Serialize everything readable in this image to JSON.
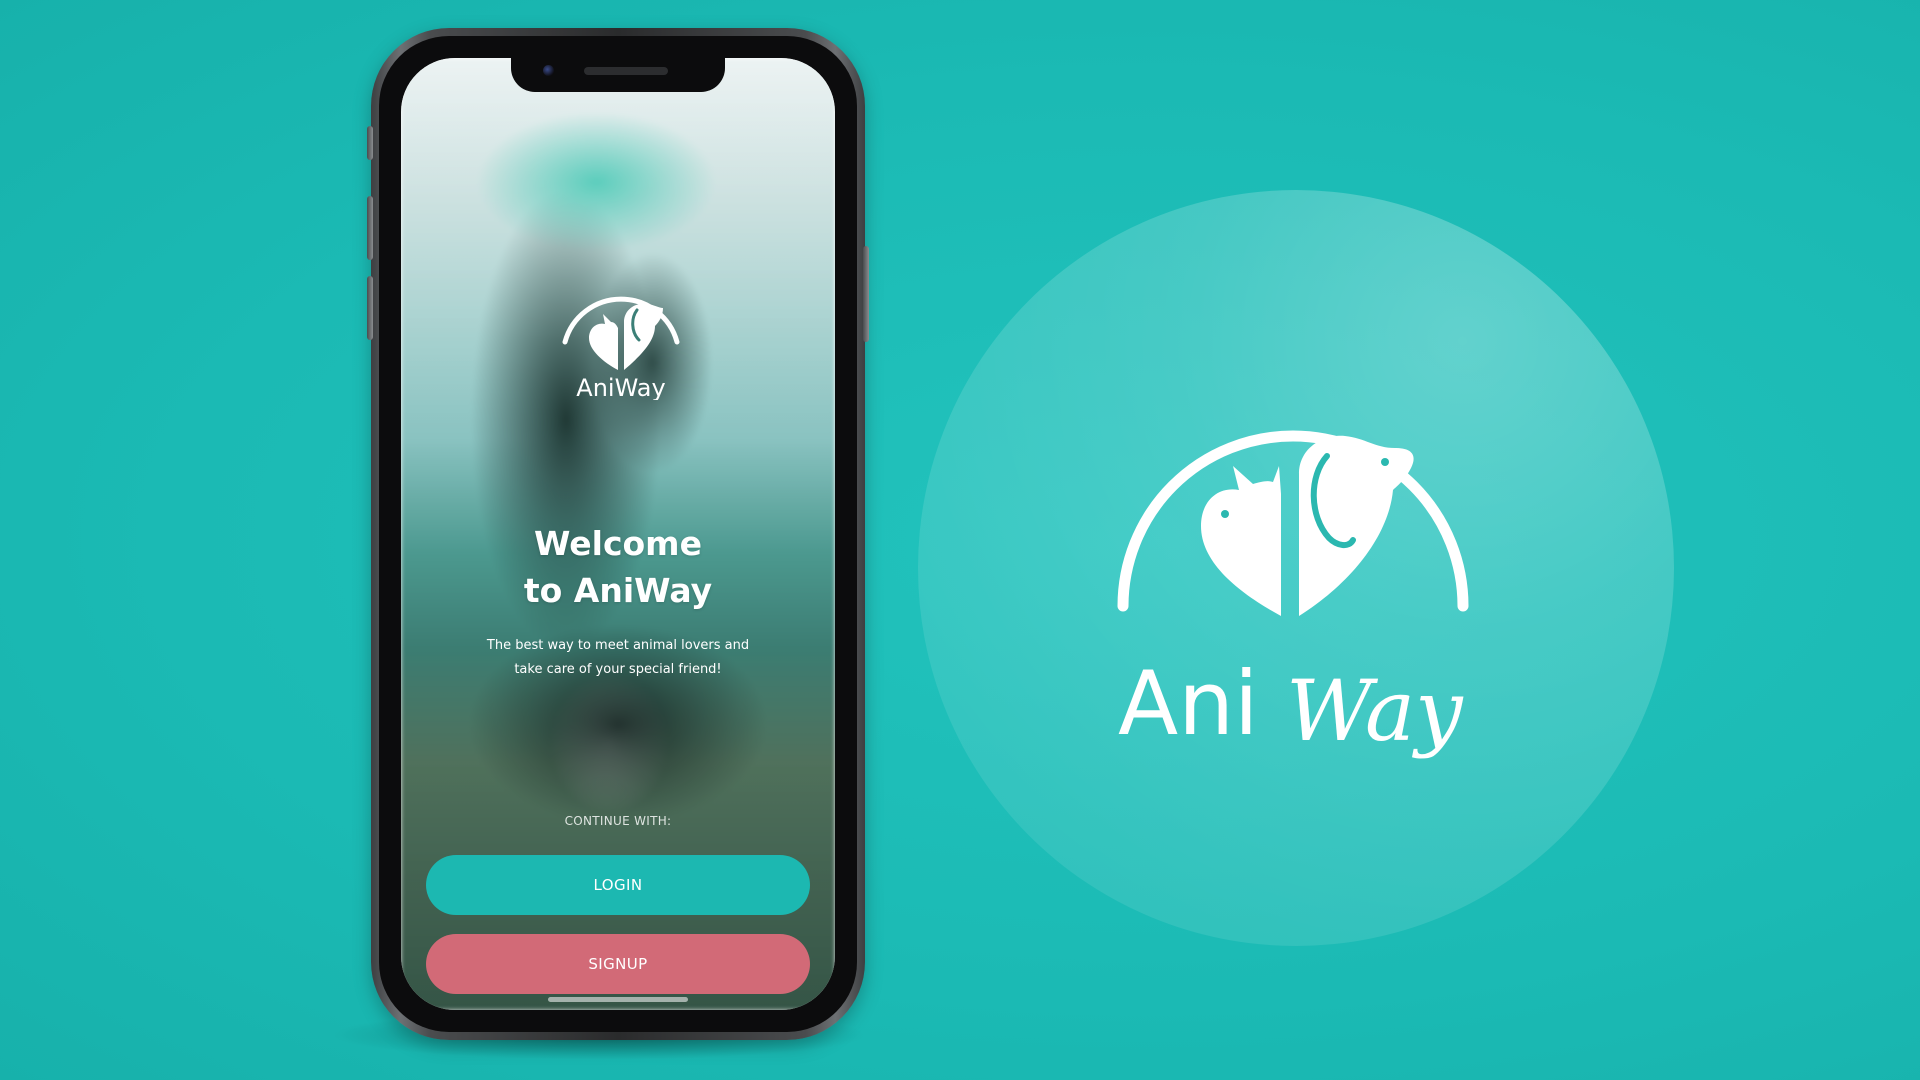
{
  "app": {
    "brand_name": "AniWay",
    "brand_name_parts": {
      "first": "Ani",
      "second": "Way"
    },
    "welcome_line1": "Welcome",
    "welcome_line2": "to AniWay",
    "subtitle_line1": "The best way to meet animal lovers and",
    "subtitle_line2": "take care of your special friend!",
    "continue_label": "CONTINUE WITH:",
    "login_label": "LOGIN",
    "signup_label": "SIGNUP"
  },
  "icons": {
    "logo": "cat-dog-heart-logo-icon"
  },
  "colors": {
    "background": "#1cbcb6",
    "login_button": "#1cb8b1",
    "signup_button": "#d26a77",
    "text": "#ffffff"
  }
}
